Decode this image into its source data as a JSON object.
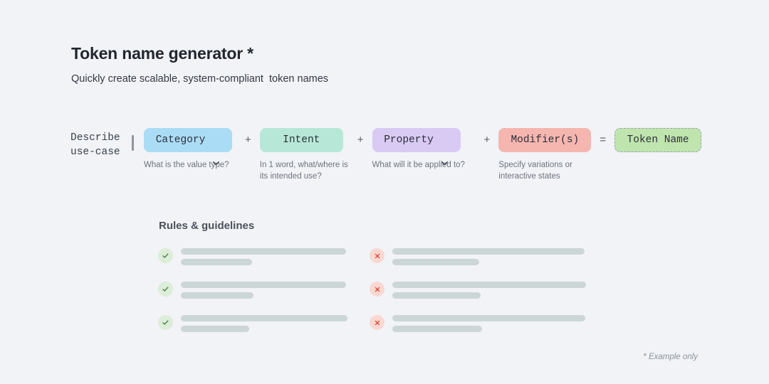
{
  "header": {
    "title": "Token name generator *",
    "subtitle": "Quickly create scalable, system-compliant  token names"
  },
  "builder": {
    "describe_label": "Describe\nuse-case",
    "slots": [
      {
        "label": "Category",
        "helper": "What is the value type?",
        "color": "#abdcf6",
        "icon": "chevron-down-icon",
        "has_chevron": true,
        "dashed": false,
        "width": 124,
        "helper_width": 130
      },
      {
        "label": "Intent",
        "helper": "In 1 word, what/where is\nits intended use?",
        "color": "#b7e8d7",
        "icon": "",
        "has_chevron": false,
        "dashed": false,
        "width": 117,
        "helper_width": 125
      },
      {
        "label": "Property",
        "helper": "What will it be applied to?",
        "color": "#d9caf4",
        "icon": "chevron-down-icon",
        "has_chevron": true,
        "dashed": false,
        "width": 124,
        "helper_width": 145
      },
      {
        "label": "Modifier(s)",
        "helper": "Specify variations or\ninteractive states",
        "color": "#f6b6b0",
        "icon": "",
        "has_chevron": false,
        "dashed": false,
        "width": 130,
        "helper_width": 128
      }
    ],
    "operators": [
      "+",
      "+",
      "+",
      "="
    ],
    "result": {
      "label": "Token Name",
      "color": "#c0e4ae",
      "dashed": true,
      "width": 122
    }
  },
  "rules": {
    "heading": "Rules & guidelines",
    "good": {
      "icon": "check-circle-icon",
      "rows": [
        {
          "long": 232,
          "short": 100
        },
        {
          "long": 232,
          "short": 102
        },
        {
          "long": 234,
          "short": 96
        }
      ]
    },
    "bad": {
      "icon": "x-circle-icon",
      "rows": [
        {
          "long": 270,
          "short": 122
        },
        {
          "long": 272,
          "short": 124
        },
        {
          "long": 271,
          "short": 126
        }
      ]
    }
  },
  "footnote": "* Example only",
  "colors": {
    "background": "#f1f3f7",
    "bar": "#cdd6d6",
    "check_bg": "#dcedd8",
    "check_mark": "#4b7b3f",
    "error_bg": "#fad8d2",
    "error_mark": "#d6452c"
  }
}
